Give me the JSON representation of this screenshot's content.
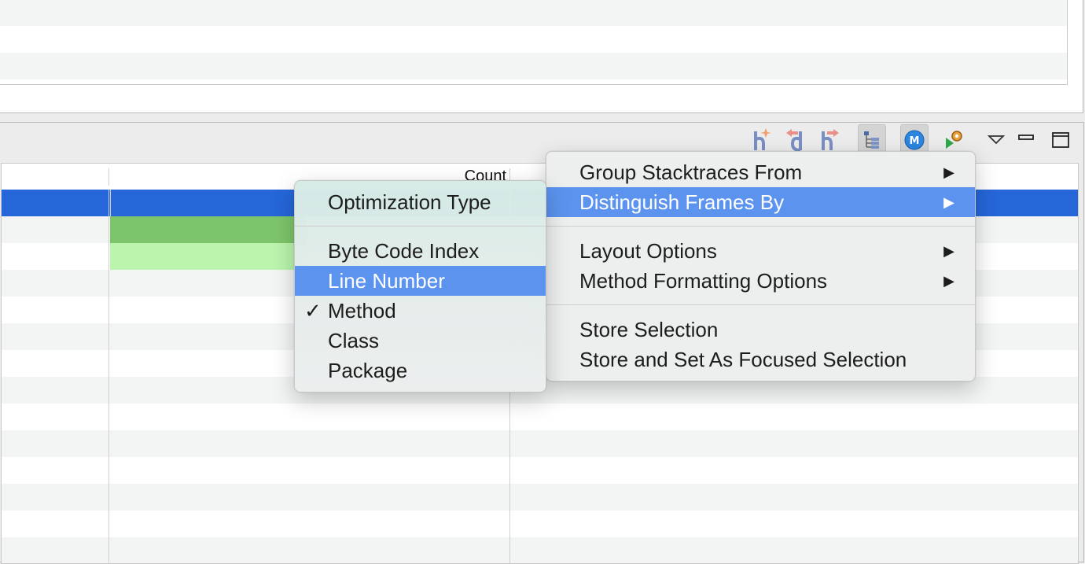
{
  "table": {
    "count_header": "Count"
  },
  "toolbar": {
    "icons": [
      "flame-add-icon",
      "flame-back-icon",
      "flame-forward-icon",
      "tree-view-icon",
      "method-m-icon",
      "run-config-icon",
      "view-menu-chevron-icon",
      "minimize-icon",
      "maximize-icon"
    ]
  },
  "context_menu": {
    "items": [
      {
        "label": "Group Stacktraces From",
        "submenu": true
      },
      {
        "label": "Distinguish Frames By",
        "submenu": true,
        "highlighted": true
      },
      {
        "label": "Layout Options",
        "submenu": true
      },
      {
        "label": "Method Formatting Options",
        "submenu": true
      },
      {
        "label": "Store Selection"
      },
      {
        "label": "Store and Set As Focused Selection"
      }
    ],
    "arrow_glyph": "▶"
  },
  "submenu": {
    "items": [
      {
        "label": "Optimization Type"
      },
      {
        "label": "Byte Code Index"
      },
      {
        "label": "Line Number",
        "highlighted": true
      },
      {
        "label": "Method",
        "checked": true
      },
      {
        "label": "Class"
      },
      {
        "label": "Package"
      }
    ],
    "check_glyph": "✓"
  },
  "colors": {
    "selection": "#2566d8",
    "menu_highlight": "#5b93ee",
    "bar_green": "#7dc56b",
    "bar_light_green": "#baf4ad",
    "submenu_tint": "#d9ebe6"
  }
}
